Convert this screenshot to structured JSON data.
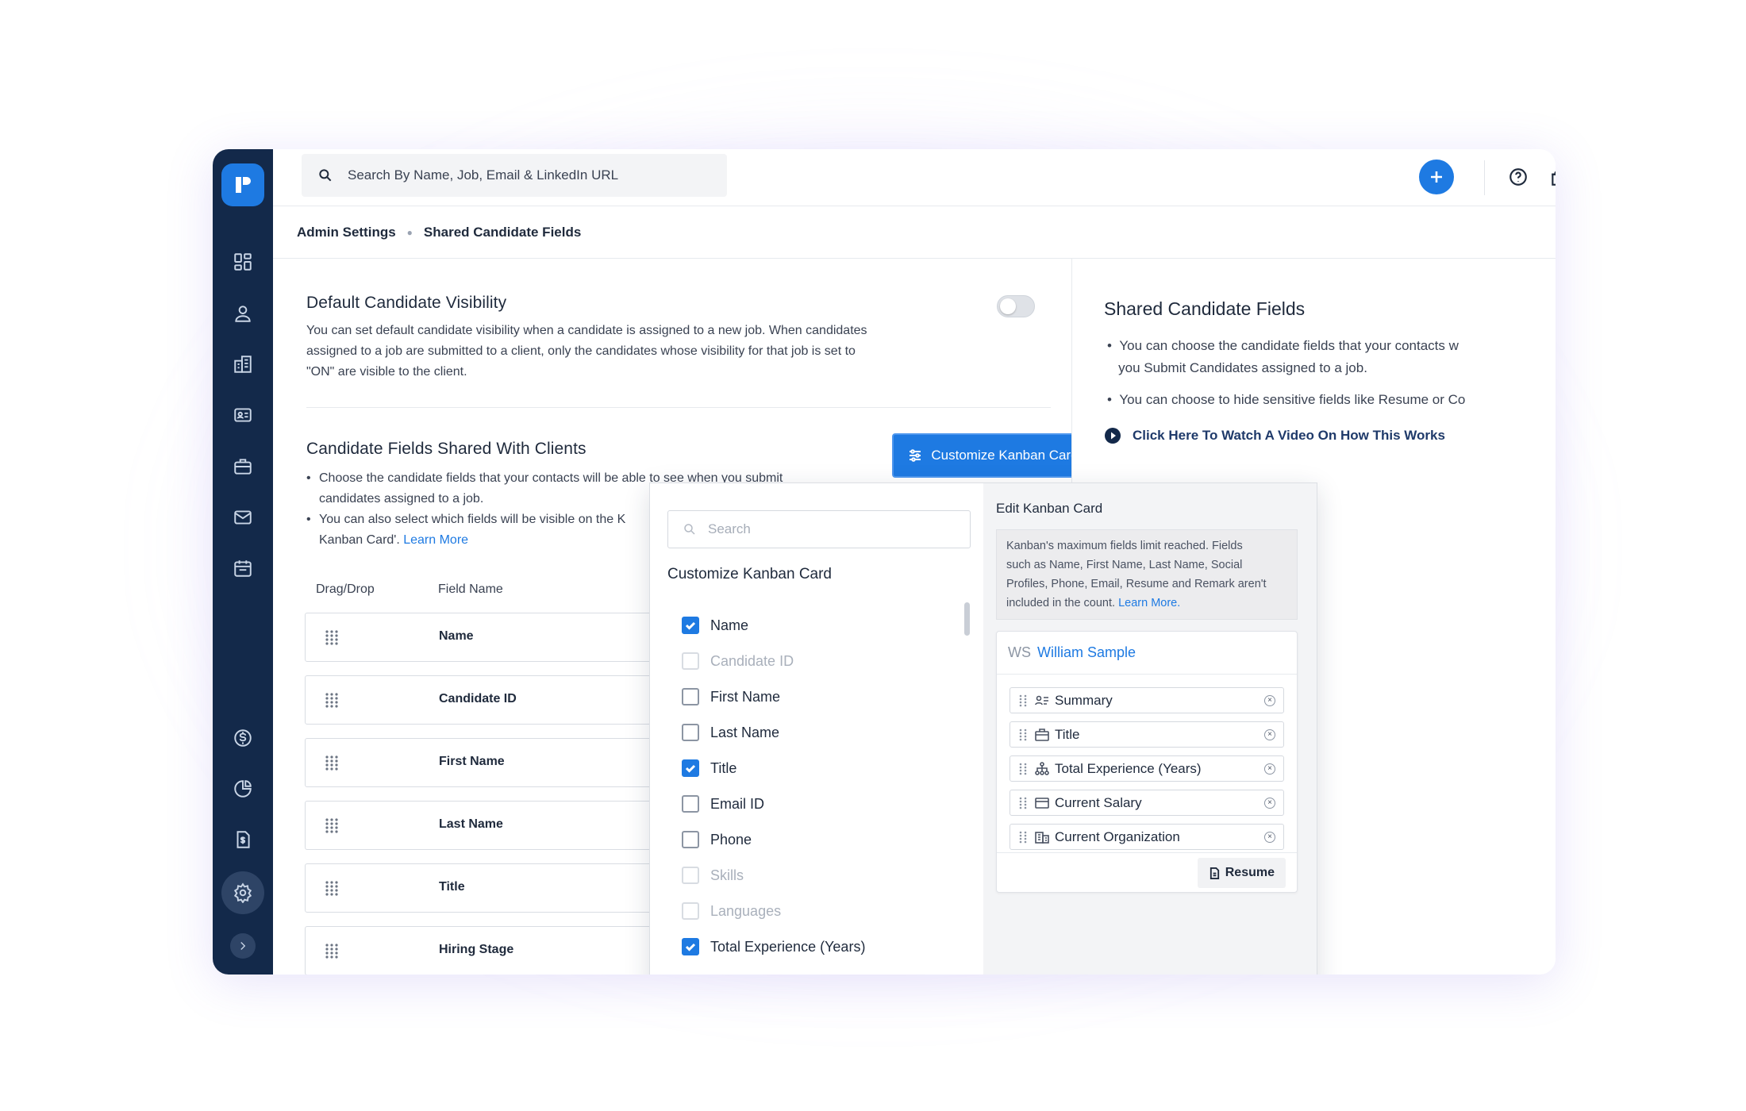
{
  "search": {
    "placeholder": "Search By Name, Job, Email & LinkedIn URL"
  },
  "breadcrumb": {
    "parent": "Admin Settings",
    "current": "Shared Candidate Fields"
  },
  "visibility": {
    "title": "Default Candidate Visibility",
    "description_lines": [
      "You can set default candidate visibility when a candidate is assigned to a new job. When candidates",
      "assigned to a job are submitted to a client, only the candidates whose visibility for that job is set to",
      "\"ON\" are visible to the client."
    ],
    "toggle_on": false
  },
  "shared": {
    "title": "Candidate Fields Shared With Clients",
    "customize_button": "Customize Kanban Card",
    "bullet1_lines": [
      "Choose the candidate fields that your contacts will be able to see when you submit",
      "candidates assigned to a job."
    ],
    "bullet2_line1": "You can also select which fields will be visible on the K",
    "bullet2_line2": "Kanban Card'. ",
    "learn_more": "Learn More",
    "columns": {
      "drag": "Drag/Drop",
      "field": "Field Name"
    },
    "fields": [
      "Name",
      "Candidate ID",
      "First Name",
      "Last Name",
      "Title",
      "Hiring Stage"
    ]
  },
  "kanban_popup": {
    "search_placeholder": "Search",
    "title": "Customize Kanban Card",
    "options": [
      {
        "label": "Name",
        "checked": true,
        "disabled": false
      },
      {
        "label": "Candidate ID",
        "checked": false,
        "disabled": true
      },
      {
        "label": "First Name",
        "checked": false,
        "disabled": false
      },
      {
        "label": "Last Name",
        "checked": false,
        "disabled": false
      },
      {
        "label": "Title",
        "checked": true,
        "disabled": false
      },
      {
        "label": "Email ID",
        "checked": false,
        "disabled": false
      },
      {
        "label": "Phone",
        "checked": false,
        "disabled": false
      },
      {
        "label": "Skills",
        "checked": false,
        "disabled": true
      },
      {
        "label": "Languages",
        "checked": false,
        "disabled": true
      },
      {
        "label": "Total Experience (Years)",
        "checked": true,
        "disabled": false
      }
    ],
    "edit": {
      "title": "Edit Kanban Card",
      "note_lines": [
        "Kanban's maximum fields limit reached. Fields",
        "such as Name, First Name, Last Name, Social",
        "Profiles, Phone, Email, Resume and Remark aren't",
        "included in the count. "
      ],
      "note_link": "Learn More.",
      "card_initials": "WS",
      "card_name": "William Sample",
      "chips": [
        {
          "label": "Summary",
          "icon": "summary-icon"
        },
        {
          "label": "Title",
          "icon": "briefcase-icon"
        },
        {
          "label": "Total Experience (Years)",
          "icon": "hierarchy-icon"
        },
        {
          "label": "Current Salary",
          "icon": "wallet-icon"
        },
        {
          "label": "Current Organization",
          "icon": "building-icon"
        }
      ],
      "resume_button": "Resume"
    }
  },
  "right_panel": {
    "title": "Shared Candidate Fields",
    "bullet1_line1": "You can choose the candidate fields that your contacts w",
    "bullet1_line2": "you Submit Candidates assigned to a job.",
    "bullet2": "You can choose to hide sensitive fields like Resume or Co",
    "video_link": "Click Here To Watch A Video On How This Works"
  },
  "colors": {
    "accent": "#1e7ae2",
    "sidebar": "#13294a"
  }
}
